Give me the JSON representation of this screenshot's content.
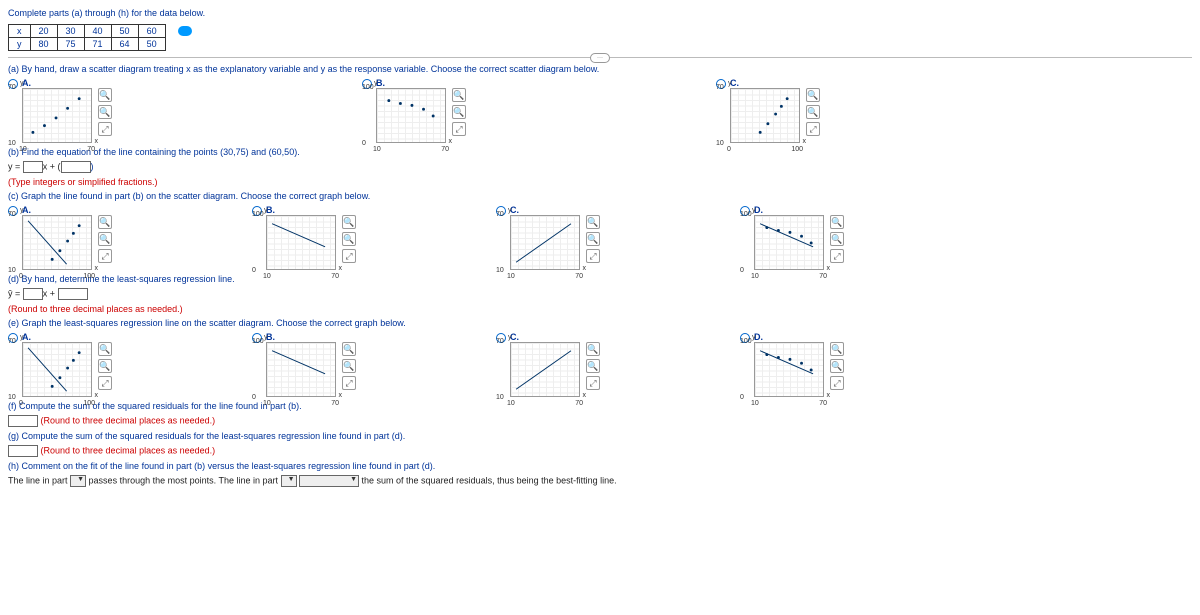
{
  "header": "Complete parts (a) through (h) for the data below.",
  "table": {
    "row1": [
      "x",
      "20",
      "30",
      "40",
      "50",
      "60"
    ],
    "row2": [
      "y",
      "80",
      "75",
      "71",
      "64",
      "50"
    ]
  },
  "a": {
    "prompt": "(a) By hand, draw a scatter diagram treating x as the explanatory variable and y as the response variable. Choose the correct scatter diagram below.",
    "A": {
      "label": "A.",
      "ytop": "70",
      "ybot": "10",
      "xleft": "10",
      "xright": "70"
    },
    "B": {
      "label": "B.",
      "ytop": "100",
      "ybot": "0",
      "xleft": "10",
      "xright": "70"
    },
    "C": {
      "label": "C.",
      "ytop": "70",
      "ybot": "10",
      "xleft": "0",
      "xright": "100"
    }
  },
  "b": {
    "prompt": "(b) Find the equation of the line containing the points (30,75) and (60,50).",
    "eq1": "y = ",
    "eq2": "x + (",
    "eq3": ")",
    "hint": "(Type integers or simplified fractions.)"
  },
  "c": {
    "prompt": "(c) Graph the line found in part (b) on the scatter diagram. Choose the correct graph below.",
    "A": {
      "label": "A.",
      "ytop": "70",
      "ybot": "10",
      "xleft": "0",
      "xright": "100"
    },
    "B": {
      "label": "B.",
      "ytop": "100",
      "ybot": "0",
      "xleft": "10",
      "xright": "70"
    },
    "C": {
      "label": "C.",
      "ytop": "70",
      "ybot": "10",
      "xleft": "10",
      "xright": "70"
    },
    "D": {
      "label": "D.",
      "ytop": "100",
      "ybot": "0",
      "xleft": "10",
      "xright": "70"
    }
  },
  "d": {
    "prompt": "(d) By hand, determine the least-squares regression line.",
    "eq1": "ŷ = ",
    "eq2": "x + ",
    "hint": "(Round to three decimal places as needed.)"
  },
  "e": {
    "prompt": "(e) Graph the least-squares regression line on the scatter diagram. Choose the correct graph below.",
    "A": {
      "label": "A.",
      "ytop": "70",
      "ybot": "10",
      "xleft": "0",
      "xright": "100"
    },
    "B": {
      "label": "B.",
      "ytop": "100",
      "ybot": "0",
      "xleft": "10",
      "xright": "70"
    },
    "C": {
      "label": "C.",
      "ytop": "70",
      "ybot": "10",
      "xleft": "10",
      "xright": "70"
    },
    "D": {
      "label": "D.",
      "ytop": "100",
      "ybot": "0",
      "xleft": "10",
      "xright": "70"
    }
  },
  "f": {
    "prompt": "(f) Compute the sum of the squared residuals for the line found in part (b).",
    "hint": "(Round to three decimal places as needed.)"
  },
  "g": {
    "prompt": "(g) Compute the sum of the squared residuals for the least-squares regression line found in part (d).",
    "hint": "(Round to three decimal places as needed.)"
  },
  "h": {
    "prompt": "(h) Comment on the fit of the line found in part (b) versus the least-squares regression line found in part (d).",
    "s1": "The line in part ",
    "s2": " passes through the most points. The line in part ",
    "s3": " the sum of the squared residuals, thus being the best-fitting line."
  },
  "icons": {
    "zi": "🔍",
    "zo": "🔍",
    "pop": "⤢"
  },
  "ylabel": "y",
  "xlabel": "x",
  "chart_data": {
    "type": "scatter",
    "x": [
      20,
      30,
      40,
      50,
      60
    ],
    "y": [
      80,
      75,
      71,
      64,
      50
    ],
    "xlabel": "x",
    "ylabel": "y",
    "title": "",
    "part_a_options": [
      {
        "key": "A",
        "xlim": [
          10,
          70
        ],
        "ylim": [
          10,
          70
        ],
        "desc": "points rising"
      },
      {
        "key": "B",
        "xlim": [
          10,
          70
        ],
        "ylim": [
          0,
          100
        ],
        "desc": "points falling (correct)"
      },
      {
        "key": "C",
        "xlim": [
          0,
          100
        ],
        "ylim": [
          10,
          70
        ],
        "desc": "points rising"
      }
    ],
    "part_c_and_e_options": [
      {
        "key": "A",
        "xlim": [
          0,
          100
        ],
        "ylim": [
          10,
          70
        ],
        "line": "falling"
      },
      {
        "key": "B",
        "xlim": [
          10,
          70
        ],
        "ylim": [
          0,
          100
        ],
        "line": "falling"
      },
      {
        "key": "C",
        "xlim": [
          10,
          70
        ],
        "ylim": [
          10,
          70
        ],
        "line": "rising"
      },
      {
        "key": "D",
        "xlim": [
          10,
          70
        ],
        "ylim": [
          0,
          100
        ],
        "line": "falling with points"
      }
    ]
  }
}
